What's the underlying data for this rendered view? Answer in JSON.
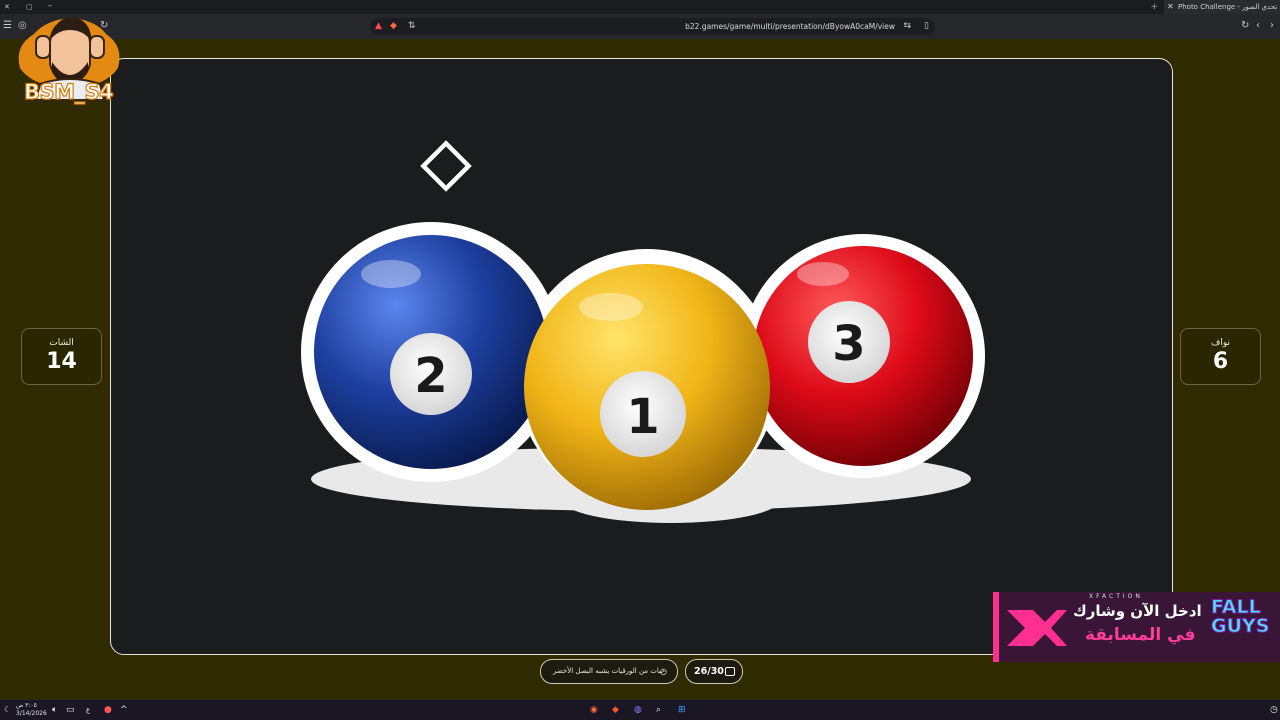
{
  "browser": {
    "active_tab_title": "Photo Challenge - تحدي الصور",
    "url": "b22.games/game/multi/presentation/dByowA0caM/view"
  },
  "game": {
    "team_left": {
      "name": "الشات",
      "score": "14"
    },
    "team_right": {
      "name": "نواف",
      "score": "6"
    },
    "hint": "نبات من الورقيات يشبه البصل الأخضر",
    "counter": "26/30",
    "balls": [
      {
        "number": "2",
        "color": "#1f43a8"
      },
      {
        "number": "1",
        "color": "#f2b51c"
      },
      {
        "number": "3",
        "color": "#e0101e"
      }
    ]
  },
  "overlay": {
    "streamer_name": "BSM_S4",
    "promo_brand": "XFACTION",
    "promo_line1": "ادخل الآن وشارك",
    "promo_line2": "في المسابقة",
    "promo_game": "FALL GUYS"
  },
  "taskbar": {
    "time": "٣:٠٥ ص",
    "date": "3/14/2026"
  }
}
